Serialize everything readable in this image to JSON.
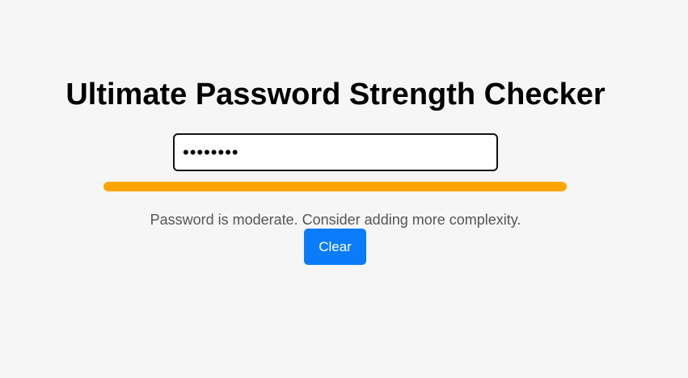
{
  "page": {
    "title": "Ultimate Password Strength Checker"
  },
  "password": {
    "masked_value": "••••••••"
  },
  "strength": {
    "level_fraction": 1.0,
    "color": "#ffa500"
  },
  "feedback": {
    "message": "Password is moderate. Consider adding more complexity."
  },
  "actions": {
    "clear_label": "Clear",
    "clear_color": "#0a7cf9"
  }
}
